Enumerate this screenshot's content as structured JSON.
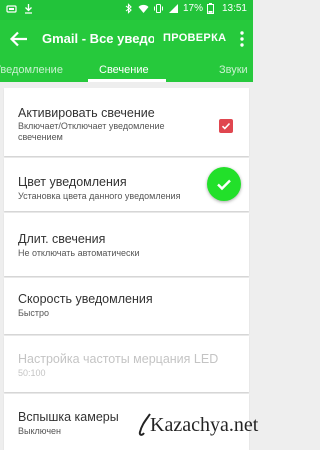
{
  "status_bar": {
    "left_icons": [
      "signal-icon",
      "download-icon"
    ],
    "right_icons": [
      "bluetooth-icon",
      "wifi-icon",
      "vibrate-icon",
      "cellular-icon",
      "battery-icon"
    ],
    "battery": "17%",
    "time": "13:51"
  },
  "toolbar": {
    "back_icon": "arrow-left-icon",
    "title": "Gmail - Все уведомления",
    "preview_label": "ПРОВЕРКА",
    "more_icon": "more-vert-icon"
  },
  "tabs": [
    {
      "label": "Уведомление",
      "selected": false
    },
    {
      "label": "Свечение",
      "selected": true
    },
    {
      "label": "Звуки",
      "selected": false
    }
  ],
  "settings": [
    {
      "title": "Активировать свечение",
      "subtitle": "Включает/Отключает уведомление свечением",
      "control": "checkbox",
      "checked": true,
      "enabled": true
    },
    {
      "title": "Цвет уведомления",
      "subtitle": "Установка цвета данного уведомления",
      "control": "color",
      "color": "#22e02a",
      "enabled": true
    },
    {
      "title": "Длит. свечения",
      "subtitle": "Не отключать автоматически",
      "enabled": true
    },
    {
      "title": "Скорость уведомления",
      "subtitle": "Быстро",
      "enabled": true
    },
    {
      "title": "Настройка частоты мерцания LED",
      "subtitle": "50:100",
      "enabled": false
    },
    {
      "title": "Вспышка камеры",
      "subtitle": "Выключен",
      "enabled": true
    }
  ],
  "watermark": "Kazachya.net",
  "colors": {
    "accent": "#26c93c",
    "checkbox": "#e0464f",
    "selected_color": "#22e02a"
  }
}
